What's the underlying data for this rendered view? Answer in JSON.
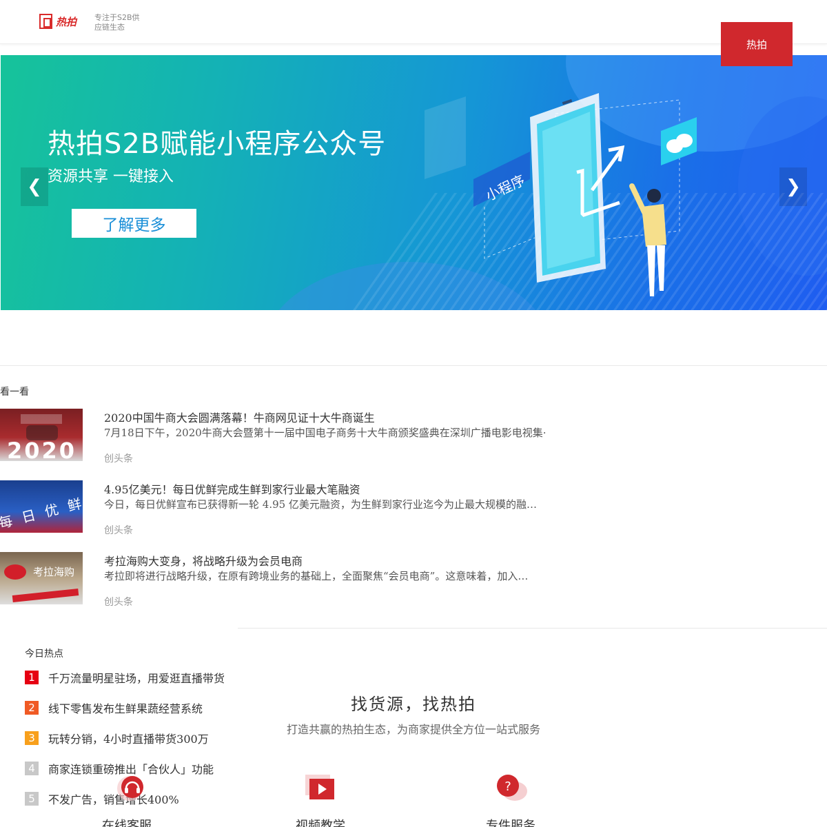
{
  "header": {
    "logo_text": "热拍",
    "tagline": "专注于S2B供应链生态",
    "nav_button": "热拍"
  },
  "banner": {
    "title": "热拍S2B赋能小程序公众号",
    "subtitle": "资源共享 一键接入",
    "cta": "了解更多",
    "prev_arrow": "❮",
    "next_arrow": "❯",
    "illustration_label": "小程序",
    "colors": {
      "start": "#16c39a",
      "end": "#1f5df0"
    }
  },
  "news": {
    "section_label": "看一看",
    "items": [
      {
        "title": "2020中国牛商大会圆满落幕！牛商网见证十大牛商诞生",
        "desc": "7月18日下午，2020牛商大会暨第十一届中国电子商务十大牛商颁奖盛典在深圳广播电影电视集·",
        "source": "创头条",
        "thumb_text": "2020"
      },
      {
        "title": "4.95亿美元！每日优鲜完成生鲜到家行业最大笔融资",
        "desc": "今日，每日优鲜宣布已获得新一轮 4.95 亿美元融资，为生鲜到家行业迄今为止最大规模的融…",
        "source": "创头条",
        "thumb_text": "每 日 优 鲜"
      },
      {
        "title": "考拉海购大变身，将战略升级为会员电商",
        "desc": "考拉即将进行战略升级，在原有跨境业务的基础上，全面聚焦“会员电商”。这意味着，加入…",
        "source": "创头条",
        "thumb_text": "考拉海购"
      }
    ]
  },
  "hot": {
    "section_label": "今日热点",
    "items": [
      {
        "rank": "1",
        "text": "千万流量明星驻场，用爱逛直播带货",
        "color": "#e60012"
      },
      {
        "rank": "2",
        "text": "线下零售发布生鲜果蔬经营系统",
        "color": "#f05a24"
      },
      {
        "rank": "3",
        "text": "玩转分销，4小时直播带货300万",
        "color": "#f8a01c"
      },
      {
        "rank": "4",
        "text": "商家连锁重磅推出「合伙人」功能",
        "color": "#c8c8c8"
      },
      {
        "rank": "5",
        "text": "不发广告，销售增长400%",
        "color": "#c8c8c8"
      }
    ]
  },
  "services": {
    "slogan": "找货源，找热拍",
    "slogan_sub": "打造共赢的热拍生态，为商家提供全方位一站式服务",
    "items": [
      {
        "label": "在线客服",
        "icon": "headset-icon"
      },
      {
        "label": "视频教学",
        "icon": "video-icon"
      },
      {
        "label": "专件服务",
        "icon": "question-chat-icon"
      }
    ]
  }
}
